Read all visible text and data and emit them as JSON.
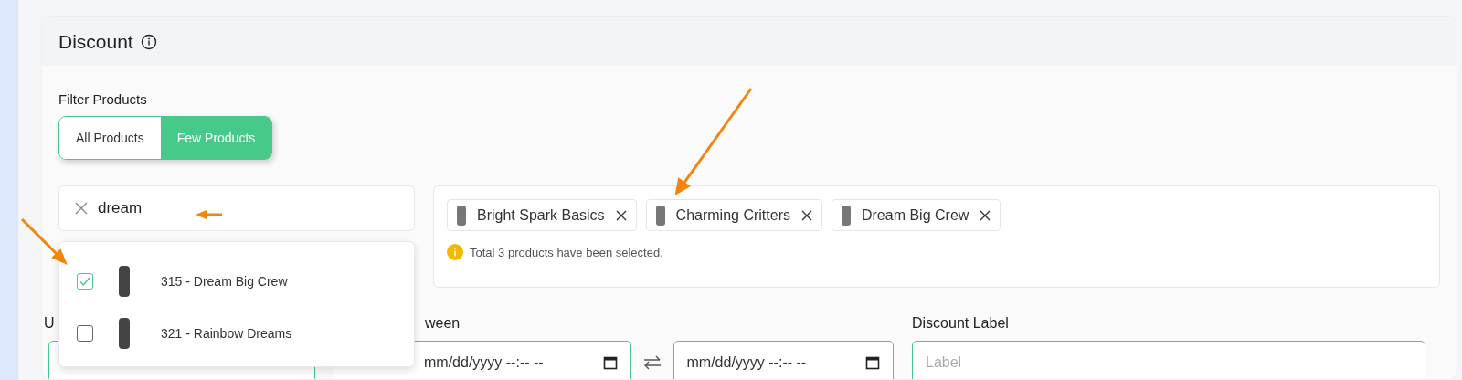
{
  "card": {
    "title": "Discount"
  },
  "filter": {
    "label": "Filter Products",
    "options": [
      {
        "label": "All Products",
        "selected": false
      },
      {
        "label": "Few Products",
        "selected": true
      }
    ]
  },
  "search": {
    "value": "dream",
    "results": [
      {
        "label": "315 - Dream Big Crew",
        "checked": true
      },
      {
        "label": "321 - Rainbow Dreams",
        "checked": false
      }
    ]
  },
  "selected_products": {
    "chips": [
      {
        "label": "Bright Spark Basics"
      },
      {
        "label": "Charming Critters"
      },
      {
        "label": "Dream Big Crew"
      }
    ],
    "summary": "Total 3 products have been selected."
  },
  "fields": [
    {
      "kind": "number",
      "label": "U"
    },
    {
      "kind": "daterange",
      "label": "ween",
      "start": "mm/dd/yyyy --:-- --",
      "end": "mm/dd/yyyy --:-- --"
    },
    {
      "kind": "text",
      "label": "Discount Label",
      "placeholder": "Label"
    }
  ]
}
